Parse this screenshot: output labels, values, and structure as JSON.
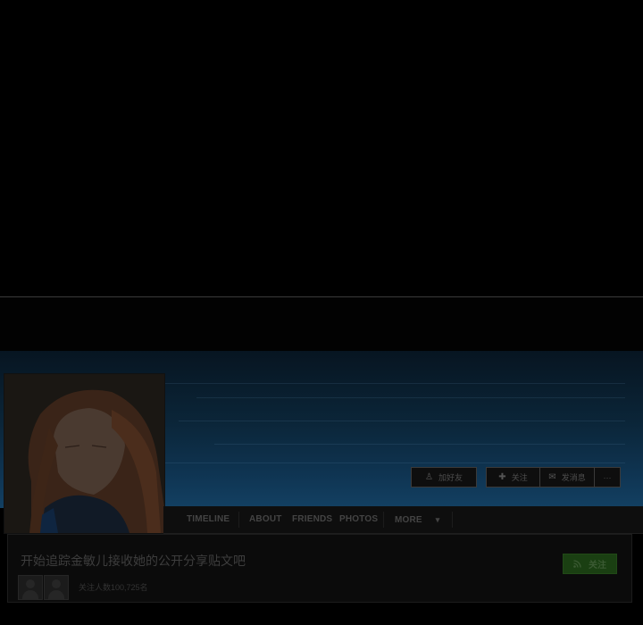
{
  "profile": {
    "actions": {
      "add_friend_label": "加好友",
      "follow_label": "关注",
      "message_label": "发消息",
      "more_label": "···"
    },
    "tabs": [
      {
        "label": "TIMELINE"
      },
      {
        "label": "ABOUT"
      },
      {
        "label": "FRIENDS"
      },
      {
        "label": "PHOTOS"
      },
      {
        "label": "MORE"
      }
    ],
    "more_arrow": "▾"
  },
  "follow_card": {
    "title": "开始追踪金敏儿接收她的公开分享贴文吧",
    "follower_count": "关注人数100,725名",
    "follow_button_label": "关注"
  },
  "icons": {
    "add_friend": "person-add-icon",
    "follow": "plus-icon",
    "message": "chat-bubble-icon",
    "rss": "rss-icon"
  }
}
